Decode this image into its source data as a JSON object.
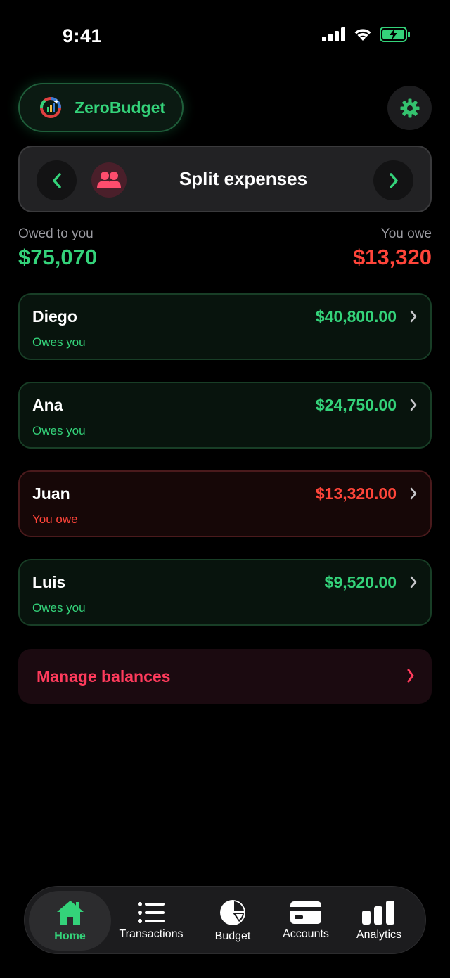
{
  "status_bar": {
    "time": "9:41"
  },
  "header": {
    "app_name": "ZeroBudget"
  },
  "selector": {
    "title": "Split expenses"
  },
  "summary": {
    "owed_label": "Owed to you",
    "owed_value": "$75,070",
    "owe_label": "You owe",
    "owe_value": "$13,320"
  },
  "people": [
    {
      "name": "Diego",
      "amount": "$40,800.00",
      "status": "Owes you"
    },
    {
      "name": "Ana",
      "amount": "$24,750.00",
      "status": "Owes you"
    },
    {
      "name": "Juan",
      "amount": "$13,320.00",
      "status": "You owe"
    },
    {
      "name": "Luis",
      "amount": "$9,520.00",
      "status": "Owes you"
    }
  ],
  "manage": {
    "label": "Manage balances"
  },
  "tabs": [
    {
      "label": "Home",
      "icon": "home-icon",
      "active": true
    },
    {
      "label": "Transactions",
      "icon": "list-icon"
    },
    {
      "label": "Budget",
      "icon": "pie-chart-icon"
    },
    {
      "label": "Accounts",
      "icon": "card-icon"
    },
    {
      "label": "Analytics",
      "icon": "bar-chart-icon"
    }
  ],
  "colors": {
    "accent_green": "#34d37a",
    "accent_red": "#ff453a",
    "accent_pink": "#ff3b5c",
    "background": "#000000"
  }
}
